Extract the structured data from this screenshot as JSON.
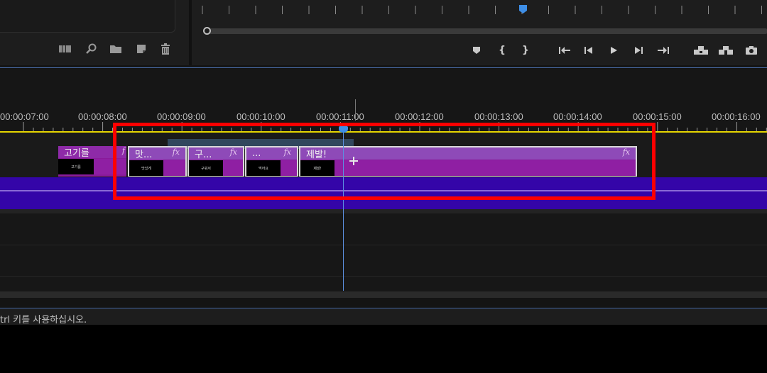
{
  "timeline": {
    "timecodes": [
      "00:00:07:00",
      "00:00:08:00",
      "00:00:09:00",
      "00:00:10:00",
      "00:00:11:00",
      "00:00:12:00",
      "00:00:13:00",
      "00:00:14:00",
      "00:00:15:00",
      "00:00:16:00"
    ],
    "clips": [
      {
        "title": "고기를",
        "fx": "",
        "thumb_text": "고기를",
        "selected": false
      },
      {
        "title": "맛...",
        "fx": "fx",
        "thumb_text": "맛있게",
        "selected": true
      },
      {
        "title": "구...",
        "fx": "fx",
        "thumb_text": "구워서",
        "selected": true
      },
      {
        "title": "...",
        "fx": "fx",
        "thumb_text": "먹어요",
        "selected": true
      },
      {
        "title": "제발!",
        "fx": "fx",
        "thumb_text": "제발!",
        "selected": true
      }
    ]
  },
  "status_bar": {
    "text": "trl 키를 사용하십시오."
  },
  "icons": {
    "project_toolbar": [
      "freeform-view-icon",
      "search-icon",
      "new-bin-icon",
      "new-item-icon",
      "trash-icon"
    ],
    "monitor_toolbar": [
      "add-marker-icon",
      "mark-in-icon",
      "mark-out-icon",
      "go-to-in-icon",
      "step-back-icon",
      "play-icon",
      "step-forward-icon",
      "go-to-out-icon",
      "lift-icon",
      "extract-icon",
      "export-frame-icon"
    ]
  },
  "colors": {
    "clip_purple": "#8a1a9a",
    "track_blue": "#3405a8",
    "timeline_yellow": "#e6d600",
    "playhead_blue": "#3e8ee6",
    "annotation_red": "#ff0000"
  }
}
